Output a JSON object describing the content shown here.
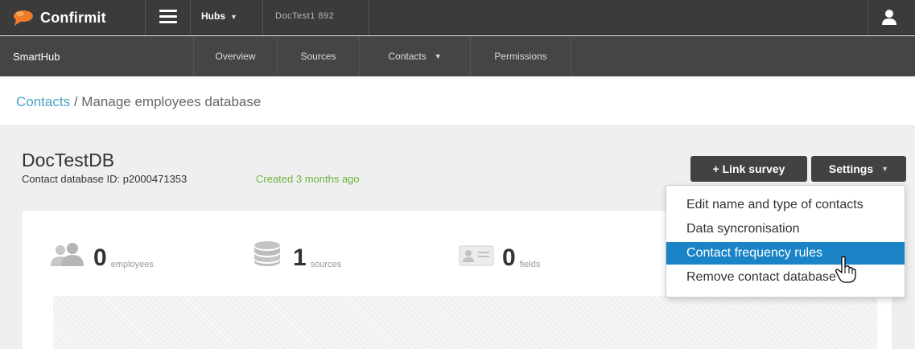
{
  "topbar": {
    "brand": "Confirmit",
    "hubs_label": "Hubs",
    "hub_name": "DocTest1 892"
  },
  "nav": {
    "brand": "SmartHub",
    "items": [
      {
        "label": "Overview"
      },
      {
        "label": "Sources"
      },
      {
        "label": "Contacts"
      },
      {
        "label": "Permissions"
      }
    ]
  },
  "breadcrumb": {
    "link": "Contacts",
    "separator": "/",
    "current": "Manage employees database"
  },
  "database": {
    "title": "DocTestDB",
    "id_text": "Contact database ID: p2000471353",
    "created_text": "Created 3 months ago"
  },
  "buttons": {
    "link_survey": "+ Link survey",
    "settings": "Settings"
  },
  "stats": [
    {
      "number": "0",
      "label": "employees",
      "icon": "users-icon"
    },
    {
      "number": "1",
      "label": "sources",
      "icon": "database-icon"
    },
    {
      "number": "0",
      "label": "fields",
      "icon": "id-card-icon"
    }
  ],
  "settings_menu": {
    "items": [
      {
        "label": "Edit name and type of contacts"
      },
      {
        "label": "Data syncronisation"
      },
      {
        "label": "Contact frequency rules"
      },
      {
        "label": "Remove contact database"
      }
    ],
    "highlighted_index": 2
  },
  "colors": {
    "topbar": "#3b3b3b",
    "navbar": "#454545",
    "link": "#4aa3c8",
    "created": "#6db33f",
    "menu_highlight": "#1a84c7",
    "button": "#424242"
  }
}
